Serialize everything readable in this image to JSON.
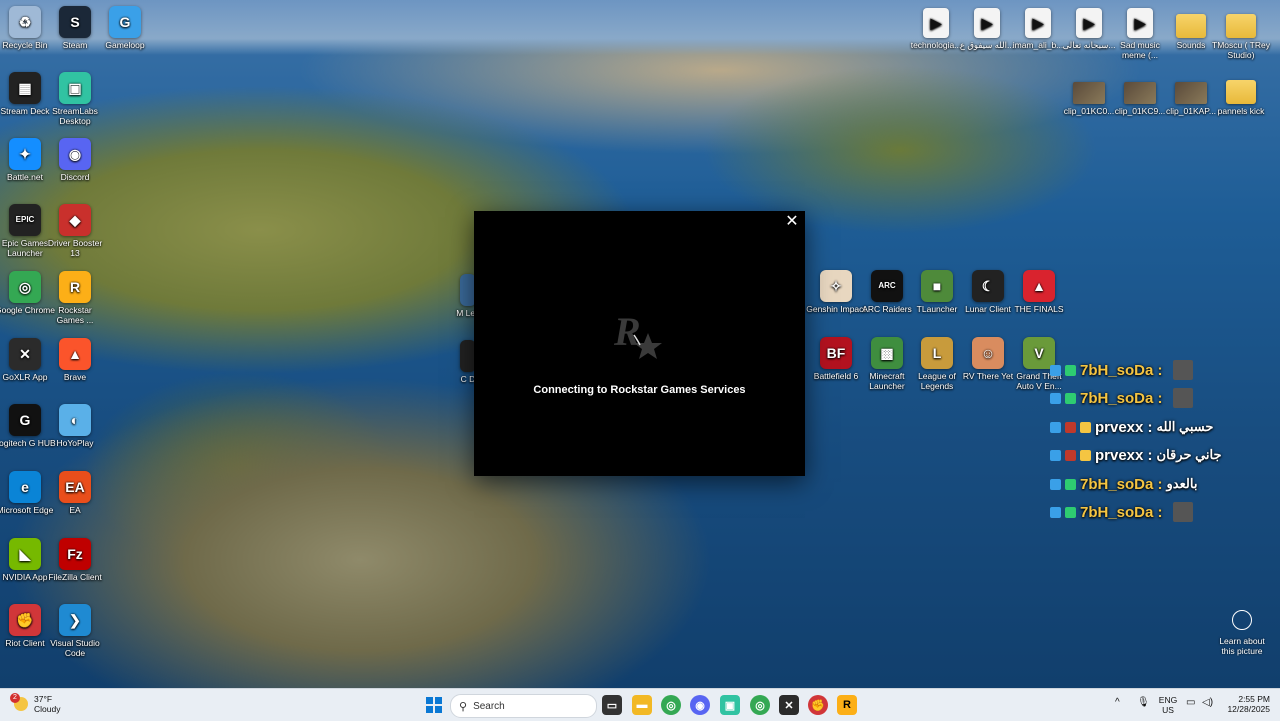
{
  "desktop": {
    "left_icons": [
      {
        "label": "Recycle Bin",
        "glyph": "♻",
        "color": "#9fb9d6"
      },
      {
        "label": "Steam",
        "glyph": "S",
        "color": "#1b2838"
      },
      {
        "label": "Gameloop",
        "glyph": "G",
        "color": "#3aa0e8"
      },
      {
        "label": "Stream Deck",
        "glyph": "▦",
        "color": "#222"
      },
      {
        "label": "StreamLabs Desktop",
        "glyph": "▣",
        "color": "#31c3a2"
      },
      {
        "label": "Battle.net",
        "glyph": "✦",
        "color": "#148eff"
      },
      {
        "label": "Discord",
        "glyph": "◉",
        "color": "#5865f2"
      },
      {
        "label": "Epic Games Launcher",
        "glyph": "EPIC",
        "color": "#222"
      },
      {
        "label": "Driver Booster 13",
        "glyph": "◆",
        "color": "#c9302c"
      },
      {
        "label": "Google Chrome",
        "glyph": "◎",
        "color": "#34a853"
      },
      {
        "label": "Rockstar Games ...",
        "glyph": "R",
        "color": "#fcaf17"
      },
      {
        "label": "GoXLR App",
        "glyph": "✕",
        "color": "#2b2b2b"
      },
      {
        "label": "Brave",
        "glyph": "▲",
        "color": "#fb542b"
      },
      {
        "label": "Logitech G HUB",
        "glyph": "G",
        "color": "#111"
      },
      {
        "label": "HoYoPlay",
        "glyph": "◐",
        "color": "#5ab0e8"
      },
      {
        "label": "Microsoft Edge",
        "glyph": "e",
        "color": "#0a84d6"
      },
      {
        "label": "EA",
        "glyph": "EA",
        "color": "#e94e1b"
      },
      {
        "label": "NVIDIA App",
        "glyph": "◣",
        "color": "#76b900"
      },
      {
        "label": "FileZilla Client",
        "glyph": "Fz",
        "color": "#bf0000"
      },
      {
        "label": "Riot Client",
        "glyph": "✊",
        "color": "#d13639"
      },
      {
        "label": "Visual Studio Code",
        "glyph": "❯",
        "color": "#1f8ad2"
      }
    ],
    "top_right_icons": [
      {
        "label": "technologia...",
        "kind": "file"
      },
      {
        "label": "الله سيفوق ع...",
        "kind": "file"
      },
      {
        "label": "imam_ali_b...",
        "kind": "file"
      },
      {
        "label": "سبحانه تعالى...",
        "kind": "file"
      },
      {
        "label": "Sad music meme (...",
        "kind": "file"
      },
      {
        "label": "Sounds",
        "kind": "folder"
      },
      {
        "label": "TMoscu ( TRey Studio)",
        "kind": "folder"
      },
      {
        "label": "clip_01KC0...",
        "kind": "thumb"
      },
      {
        "label": "clip_01KC9...",
        "kind": "thumb"
      },
      {
        "label": "clip_01KAP...",
        "kind": "thumb"
      },
      {
        "label": "pannels kick",
        "kind": "folder"
      }
    ],
    "middle_icons": [
      {
        "label": "Genshin Impact",
        "glyph": "✧",
        "color": "#e8d7c0"
      },
      {
        "label": "ARC Raiders",
        "glyph": "ARC",
        "color": "#111"
      },
      {
        "label": "TLauncher",
        "glyph": "■",
        "color": "#4e8a3a"
      },
      {
        "label": "Lunar Client",
        "glyph": "☾",
        "color": "#222"
      },
      {
        "label": "THE FINALS",
        "glyph": "▲",
        "color": "#d9232e"
      },
      {
        "label": "Battlefield 6",
        "glyph": "BF",
        "color": "#b3121f"
      },
      {
        "label": "Minecraft Launcher",
        "glyph": "▩",
        "color": "#3f8e3f"
      },
      {
        "label": "League of Legends",
        "glyph": "L",
        "color": "#c89b3c"
      },
      {
        "label": "RV There Yet",
        "glyph": "☺",
        "color": "#d98c5f"
      },
      {
        "label": "Grand Theft Auto V En...",
        "glyph": "V",
        "color": "#6a9a3a"
      }
    ],
    "partial_icons": [
      {
        "label": "M Leg"
      },
      {
        "label": "C D"
      }
    ]
  },
  "dialog": {
    "message": "Connecting to Rockstar Games Services",
    "close": "✕"
  },
  "chat": [
    {
      "user": "7bH_soDa :",
      "text": "",
      "color": "#f5c542"
    },
    {
      "user": "7bH_soDa :",
      "text": "",
      "color": "#f5c542"
    },
    {
      "user": "prvexx :",
      "text": "حسبي الله",
      "color": "#ffffff"
    },
    {
      "user": "prvexx :",
      "text": "جاني حرقان",
      "color": "#ffffff"
    },
    {
      "user": "7bH_soDa :",
      "text": "بالعدو",
      "color": "#f5c542"
    },
    {
      "user": "7bH_soDa :",
      "text": "",
      "color": "#f5c542"
    }
  ],
  "learn": {
    "label": "Learn about this picture"
  },
  "taskbar": {
    "weather_temp": "37°F",
    "weather_desc": "Cloudy",
    "weather_badge": "2",
    "search_placeholder": "Search",
    "lang": "ENG",
    "region": "US",
    "time": "2:55 PM",
    "date": "12/28/2025"
  }
}
